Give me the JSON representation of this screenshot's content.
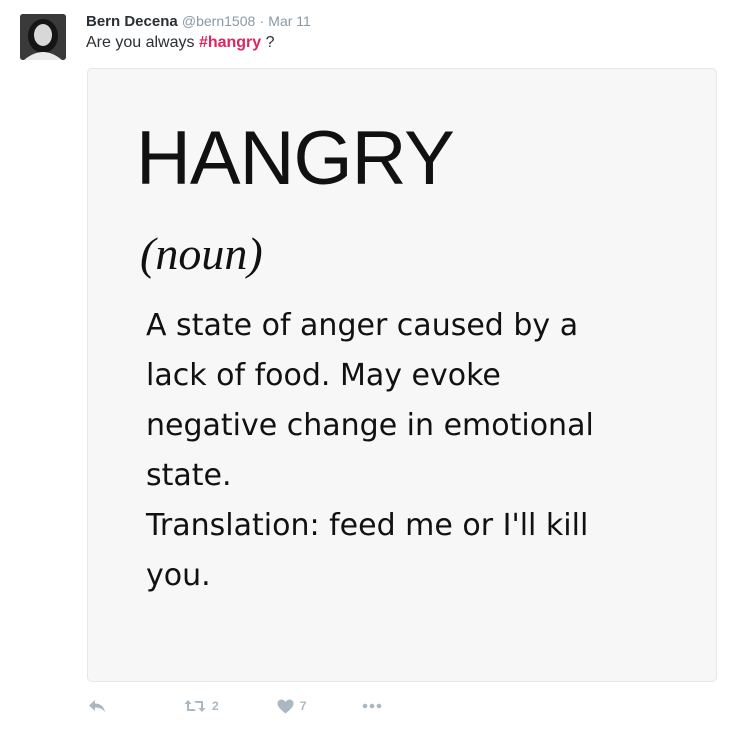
{
  "tweet": {
    "author_name": "Bern Decena",
    "author_handle": "@bern1508",
    "separator": "·",
    "date": "Mar 11",
    "text_before": "Are you always ",
    "hashtag": "#hangry",
    "text_after": " ?"
  },
  "card": {
    "word": "HANGRY",
    "part_of_speech": "(noun)",
    "definition_lines": [
      "A state of anger caused by a",
      "lack of food. May evoke",
      "negative change in emotional",
      "state.",
      "Translation: feed me or I'll kill",
      "you."
    ]
  },
  "actions": {
    "reply_icon": "reply-icon",
    "retweet_icon": "retweet-icon",
    "retweet_count": "2",
    "like_icon": "heart-icon",
    "like_count": "7",
    "more_icon": "more-icon"
  },
  "colors": {
    "hashtag": "#e0245e",
    "muted": "#8899a6",
    "action": "#aab8c2"
  }
}
